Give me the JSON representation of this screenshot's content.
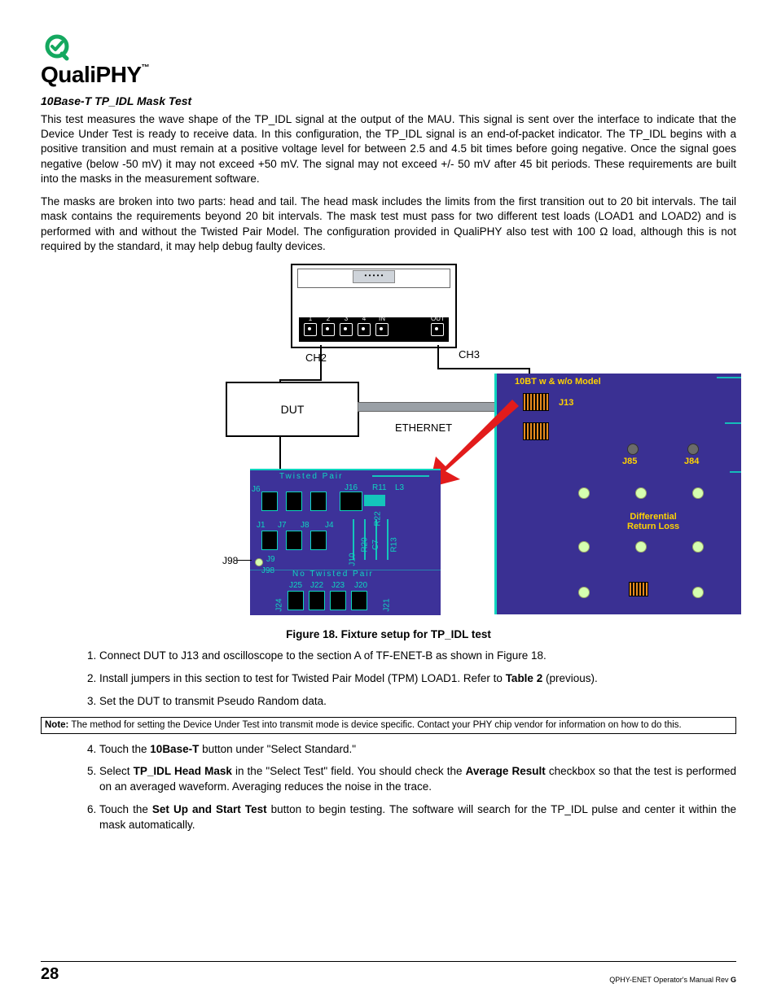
{
  "logo": {
    "brand_a": "Quali",
    "brand_b": "PHY",
    "tm": "™"
  },
  "section_title": "10Base-T TP_IDL Mask Test",
  "para1": "This test measures the wave shape of the TP_IDL signal at the output of the MAU. This signal is sent over the interface to indicate that the Device Under Test is ready to receive data. In this configuration, the TP_IDL signal is an end-of-packet indicator. The TP_IDL begins with a positive transition and must remain at a positive voltage level for between 2.5 and 4.5 bit times before going negative. Once the signal goes negative (below -50 mV) it may not exceed +50 mV. The signal may not exceed +/- 50 mV after 45 bit periods. These requirements are built into the masks in the measurement software.",
  "para2": "The masks are broken into two parts: head and tail. The head mask includes the limits from the first transition out to 20 bit intervals. The tail mask contains the requirements beyond 20 bit intervals. The mask test must pass for two different test loads (LOAD1 and LOAD2) and is performed with and without the Twisted Pair Model. The configuration provided in QualiPHY also test with 100 Ω load, although this is not required by the standard, it may help debug faulty devices.",
  "figure": {
    "caption": "Figure 18. Fixture setup for TP_IDL test",
    "scope_ports": [
      "1",
      "2",
      "3",
      "4",
      "IN",
      "OUT"
    ],
    "ch2": "CH2",
    "ch3": "CH3",
    "dut": "DUT",
    "ethernet": "ETHERNET",
    "board_title": "10BT w & w/o Model",
    "j13": "J13",
    "j85": "J85",
    "j84": "J84",
    "drl": "Differential\nReturn Loss",
    "tw_pair": "Twisted Pair",
    "no_tw_pair": "No Twisted Pair",
    "j98_side": "J98",
    "sub_refs": {
      "j6": "J6",
      "j16": "J16",
      "r11": "R11",
      "l3": "L3",
      "j1": "J1",
      "j7": "J7",
      "j8": "J8",
      "j4": "J4",
      "r22": "R22",
      "r20": "R20",
      "c7": "C7",
      "r13": "R13",
      "j9": "J9",
      "j98": "J98",
      "j10": "J10",
      "j25": "J25",
      "j22": "J22",
      "j23": "J23",
      "j20": "J20",
      "j24": "J24",
      "j21": "J21"
    }
  },
  "steps_a": [
    {
      "pre": "Connect DUT to J13 and oscilloscope to the section A of TF-ENET-B as shown in ",
      "link": "Figure 18",
      "post": "."
    },
    {
      "pre": "Install jumpers in this section to test for Twisted Pair Model (TPM) LOAD1. Refer to ",
      "bold": "Table 2",
      "post": " (previous)."
    },
    {
      "pre": "Set the DUT to transmit Pseudo Random data.",
      "bold": "",
      "post": ""
    }
  ],
  "note": {
    "label": "Note:",
    "text": " The method for setting the Device Under Test into transmit mode is device specific. Contact your PHY chip vendor for information on how to do this."
  },
  "steps_b": [
    {
      "pre": "Touch the ",
      "b1": "10Base-T",
      "mid": " button under \"Select Standard.\""
    },
    {
      "pre": "Select ",
      "b1": "TP_IDL Head Mask",
      "mid": " in the \"Select Test\" field. You should check the ",
      "b2": "Average Result",
      "post": " checkbox so that the test is performed on an averaged waveform. Averaging reduces the noise in the trace."
    },
    {
      "pre": "Touch the ",
      "b1": "Set Up and Start Test",
      "mid": " button to begin testing. The software will search for the TP_IDL pulse and center it within the mask automatically."
    }
  ],
  "footer": {
    "page": "28",
    "right_pre": "QPHY-ENET Operator's Manual Rev ",
    "right_bold": "G"
  }
}
